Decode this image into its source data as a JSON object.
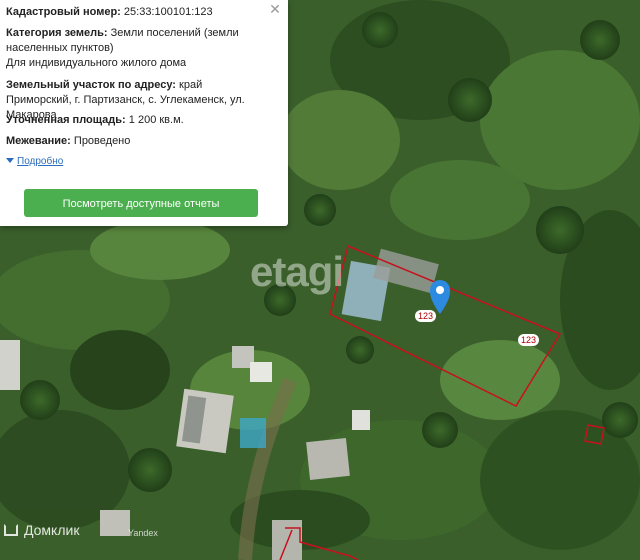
{
  "popup": {
    "cadastral_label": "Кадастровый номер:",
    "cadastral_value": "25:33:100101:123",
    "category_label": "Категория земель:",
    "category_value": "Земли поселений (земли населенных пунктов)",
    "usage_value": "Для индивидуального жилого дома",
    "address_label": "Земельный участок по адресу:",
    "address_value": "край Приморский, г. Партизанск, с. Углекаменск, ул. Макарова",
    "area_label": "Уточненная площадь:",
    "area_value": "1 200 кв.м.",
    "survey_label": "Межевание:",
    "survey_value": "Проведено",
    "more_link": "Подробно",
    "reports_button": "Посмотреть доступные отчеты",
    "close_icon": "close-icon"
  },
  "map": {
    "parcel_labels": [
      "123",
      "123"
    ],
    "watermark": "etagi",
    "brand": "Домклик",
    "provider": "Yandex",
    "pin_icon": "map-pin-icon",
    "colors": {
      "boundary": "#c8101e",
      "pin": "#2c8be0",
      "button": "#4caf4f",
      "link": "#2a6dbd"
    }
  }
}
